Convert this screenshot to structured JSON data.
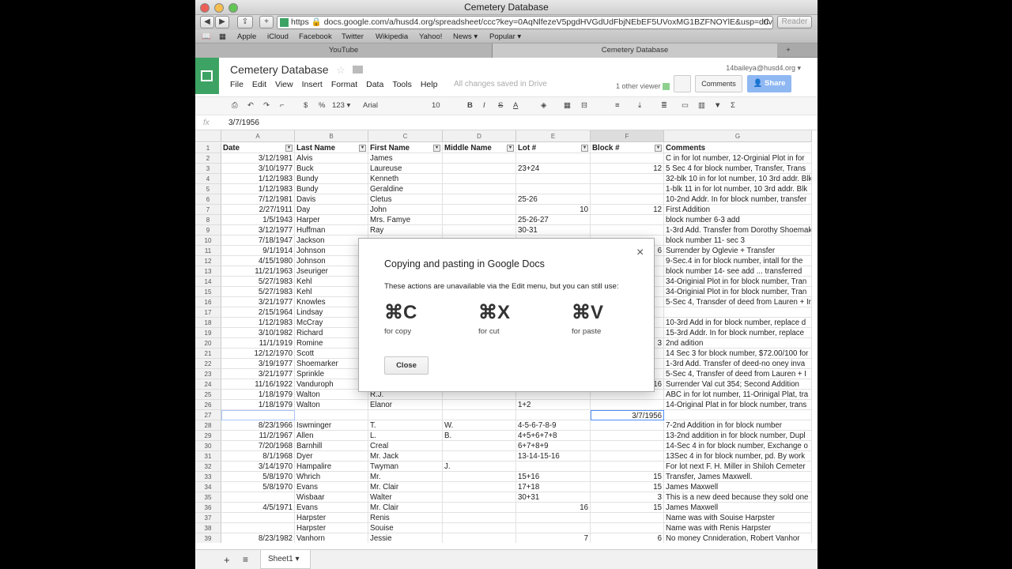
{
  "window": {
    "title": "Cemetery Database"
  },
  "nav": {
    "back": "◀",
    "forward": "▶",
    "share": "⇪",
    "add": "+",
    "url_https": "https",
    "url": "docs.google.com/a/husd4.org/spreadsheet/ccc?key=0AqNlfezeV5pgdHVGdUdFbjNEbEF5UVoxMG1BZFNOYlE&usp=drive_w",
    "reload": "C",
    "reader": "Reader"
  },
  "bookmarks": [
    "Apple",
    "iCloud",
    "Facebook",
    "Twitter",
    "Wikipedia",
    "Yahoo!",
    "News ▾",
    "Popular ▾"
  ],
  "tabs": [
    "YouTube",
    "Cemetery Database"
  ],
  "doc": {
    "title": "Cemetery Database",
    "saved": "All changes saved in Drive",
    "account": "14baileya@husd4.org ▾",
    "viewer": "1 other viewer",
    "comments": "Comments",
    "share": "Share"
  },
  "menu": [
    "File",
    "Edit",
    "View",
    "Insert",
    "Format",
    "Data",
    "Tools",
    "Help"
  ],
  "toolbar": {
    "font": "Arial",
    "size": "10",
    "fmt": "123 ▾",
    "currency": "$",
    "percent": "%",
    "bold": "B",
    "italic": "I",
    "strike": "S",
    "sigma": "Σ"
  },
  "formula": {
    "fx": "fx",
    "value": "3/7/1956"
  },
  "columns": [
    "A",
    "B",
    "C",
    "D",
    "E",
    "F",
    "G"
  ],
  "header": [
    "Date",
    "Last Name",
    "First Name",
    "Middle Name",
    "Lot #",
    "Block #",
    "Comments"
  ],
  "rows": [
    [
      "2",
      "3/12/1981",
      "Alvis",
      "James",
      "",
      "",
      "",
      "C in for lot number, 12-Orginial Plot in for"
    ],
    [
      "3",
      "3/10/1977",
      "Buck",
      "Laureuse",
      "",
      "23+24",
      "12",
      "5 Sec 4 for block number, Transfer, Trans"
    ],
    [
      "4",
      "1/12/1983",
      "Bundy",
      "Kenneth",
      "",
      "",
      "",
      "32-blk 10 in for lot number, 10 3rd addr. Blk"
    ],
    [
      "5",
      "1/12/1983",
      "Bundy",
      "Geraldine",
      "",
      "",
      "",
      "1-blk 11 in for lot number, 10 3rd addr. Blk"
    ],
    [
      "6",
      "7/12/1981",
      "Davis",
      "Cletus",
      "",
      "25-26",
      "",
      "10-2nd Addr. In for block number, transfer"
    ],
    [
      "7",
      "2/27/1911",
      "Day",
      "John",
      "",
      "10",
      "12",
      "First Addition"
    ],
    [
      "8",
      "1/5/1943",
      "Harper",
      "Mrs. Famye",
      "",
      "25-26-27",
      "",
      "block number 6-3 add"
    ],
    [
      "9",
      "3/12/1977",
      "Huffman",
      "Ray",
      "",
      "30-31",
      "",
      "1-3rd Add. Transfer from Dorothy Shoemake"
    ],
    [
      "10",
      "7/18/1947",
      "Jackson",
      "",
      "",
      "",
      "",
      "block number 11- sec 3"
    ],
    [
      "11",
      "9/1/1914",
      "Johnson",
      "",
      "",
      "",
      "6",
      "Surrender by Oglevie + Transfer"
    ],
    [
      "12",
      "4/15/1980",
      "Johnson",
      "",
      "",
      "",
      "",
      "9-Sec.4 in for block number, intall for the"
    ],
    [
      "13",
      "11/21/1963",
      "Jseuriger",
      "",
      "",
      "",
      "",
      "block number 14- see add ... transferred"
    ],
    [
      "14",
      "5/27/1983",
      "Kehl",
      "",
      "",
      "",
      "",
      "34-Originial Plot in for block number, Tran"
    ],
    [
      "15",
      "5/27/1983",
      "Kehl",
      "",
      "",
      "",
      "",
      "34-Originial Plot in for block number, Tran"
    ],
    [
      "16",
      "3/21/1977",
      "Knowles",
      "",
      "",
      "",
      "",
      "5-Sec 4, Transder of deed from Lauren + Ir"
    ],
    [
      "17",
      "2/15/1964",
      "Lindsay",
      "",
      "",
      "",
      "",
      ""
    ],
    [
      "18",
      "1/12/1983",
      "McCray",
      "",
      "",
      "",
      "",
      "10-3rd Add in for block number, replace d"
    ],
    [
      "19",
      "3/10/1982",
      "Richard",
      "",
      "",
      "",
      "",
      "15-3rd Addr. In for block number, replace"
    ],
    [
      "20",
      "11/1/1919",
      "Romine",
      "",
      "",
      "",
      "3",
      "2nd adition"
    ],
    [
      "21",
      "12/12/1970",
      "Scott",
      "",
      "",
      "",
      "",
      "14 Sec 3 for block number, $72.00/100 for"
    ],
    [
      "22",
      "3/19/1977",
      "Shoemarker",
      "",
      "",
      "",
      "",
      "1-3rd Add. Transfer of deed-no oney inva"
    ],
    [
      "23",
      "3/21/1977",
      "Sprinkle",
      "",
      "",
      "",
      "",
      "5-Sec 4, Transfer of deed from Lauren + I"
    ],
    [
      "24",
      "11/16/1922",
      "Vanduroph",
      "",
      "",
      "",
      "16",
      "Surrender Val cut 354; Second Addition"
    ],
    [
      "25",
      "1/18/1979",
      "Walton",
      "R.J.",
      "",
      "",
      "",
      "ABC in for lot number, 11-Orinigal Plat, tra"
    ],
    [
      "26",
      "1/18/1979",
      "Walton",
      "Elanor",
      "",
      "1+2",
      "",
      "14-Original Plat in for block number, trans"
    ],
    [
      "27",
      "",
      "",
      "",
      "",
      "",
      "3/7/1956",
      ""
    ],
    [
      "28",
      "8/23/1966",
      "Iswminger",
      "T.",
      "W.",
      "4-5-6-7-8-9",
      "",
      "7-2nd Addition in for block number"
    ],
    [
      "29",
      "11/2/1967",
      "Allen",
      "L.",
      "B.",
      "4+5+6+7+8",
      "",
      "13-2nd addition in for block number, Dupl"
    ],
    [
      "30",
      "7/20/1968",
      "Barnhill",
      "Creal",
      "",
      "6+7+8+9",
      "",
      "14-Sec 4 in for block number, Exchange o"
    ],
    [
      "31",
      "8/1/1968",
      "Dyer",
      "Mr. Jack",
      "",
      "13-14-15-16",
      "",
      "13Sec 4 in for block number, pd. By work"
    ],
    [
      "32",
      "3/14/1970",
      "Hampalire",
      "Twyman",
      "J.",
      "",
      "",
      "For lot next F. H. Miller in Shiloh Cemeter"
    ],
    [
      "33",
      "5/8/1970",
      "Whrich",
      "Mr.",
      "",
      "15+16",
      "15",
      "Transfer, James Maxwell."
    ],
    [
      "34",
      "5/8/1970",
      "Evans",
      "Mr. Clair",
      "",
      "17+18",
      "15",
      "James Maxwell"
    ],
    [
      "35",
      "",
      "Wisbaar",
      "Walter",
      "",
      "30+31",
      "3",
      "This is a new deed because they sold one"
    ],
    [
      "36",
      "4/5/1971",
      "Evans",
      "Mr. Clair",
      "",
      "16",
      "15",
      "James Maxwell"
    ],
    [
      "37",
      "",
      "Harpster",
      "Renis",
      "",
      "",
      "",
      "Name was with Souise Harpster"
    ],
    [
      "38",
      "",
      "Harpster",
      "Souise",
      "",
      "",
      "",
      "Name was with Renis Harpster"
    ],
    [
      "39",
      "8/23/1982",
      "Vanhorn",
      "Jessie",
      "",
      "7",
      "6",
      "No money Cnnideration, Robert Vanhor"
    ]
  ],
  "dialog": {
    "title": "Copying and pasting in Google Docs",
    "close_x": "×",
    "message": "These actions are unavailable via the Edit menu, but you can still use:",
    "keys": [
      {
        "key": "⌘C",
        "label": "for copy"
      },
      {
        "key": "⌘X",
        "label": "for cut"
      },
      {
        "key": "⌘V",
        "label": "for paste"
      }
    ],
    "button": "Close"
  },
  "sheetbar": {
    "add": "+",
    "list": "≡",
    "sheet": "Sheet1 ▾"
  }
}
